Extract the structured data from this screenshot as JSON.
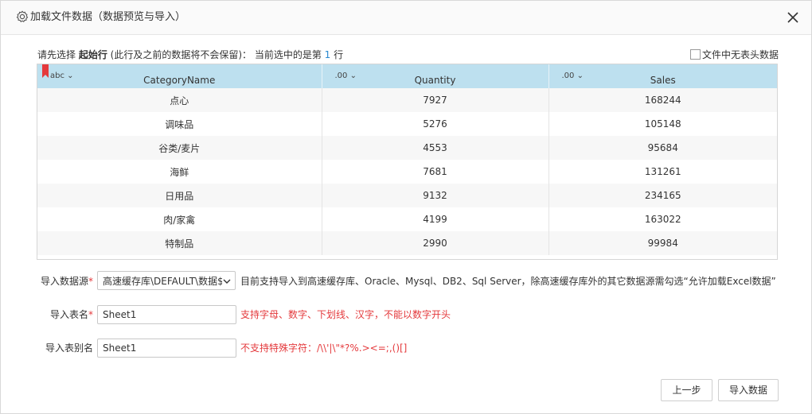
{
  "dialog": {
    "title": "加载文件数据（数据预览与导入）",
    "title_icon": "gear-icon",
    "close_icon": "close-icon"
  },
  "hint": {
    "prefix": "请先选择 ",
    "bold": "起始行",
    "middle": " (此行及之前的数据将不会保留)：  当前选中的是第 ",
    "row_number": "1",
    "suffix": " 行"
  },
  "no_header_checkbox": {
    "label": "文件中无表头数据",
    "checked": false
  },
  "grid": {
    "columns": [
      {
        "type": "abc",
        "name": "CategoryName"
      },
      {
        "type": ".00",
        "name": "Quantity"
      },
      {
        "type": ".00",
        "name": "Sales"
      }
    ],
    "rows": [
      [
        "点心",
        "7927",
        "168244"
      ],
      [
        "调味品",
        "5276",
        "105148"
      ],
      [
        "谷类/麦片",
        "4553",
        "95684"
      ],
      [
        "海鲜",
        "7681",
        "131261"
      ],
      [
        "日用品",
        "9132",
        "234165"
      ],
      [
        "肉/家禽",
        "4199",
        "163022"
      ],
      [
        "特制品",
        "2990",
        "99984"
      ]
    ]
  },
  "form": {
    "source_label": "导入数据源",
    "source_value": "高速缓存库\\DEFAULT\\数据$",
    "source_note": "目前支持导入到高速缓存库、Oracle、Mysql、DB2、Sql Server，除高速缓存库外的其它数据源需勾选“允许加载Excel数据”",
    "table_label": "导入表名",
    "table_value": "Sheet1",
    "table_note": "支持字母、数字、下划线、汉字，不能以数字开头",
    "alias_label": "导入表别名",
    "alias_value": "Sheet1",
    "alias_note": "不支持特殊字符：/\\\\'|\\\"*?%.><=;,()[]"
  },
  "buttons": {
    "prev": "上一步",
    "import": "导入数据"
  },
  "colors": {
    "header_bg": "#bde0ef",
    "required": "#e4393c",
    "accent": "#2b8ad1"
  }
}
